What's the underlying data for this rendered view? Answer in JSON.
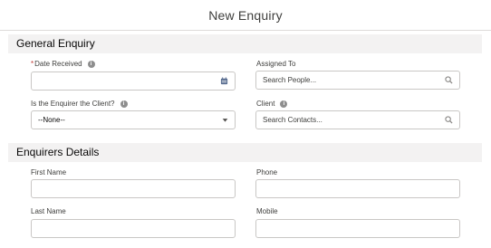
{
  "modal": {
    "title": "New Enquiry"
  },
  "sections": [
    {
      "title": "General Enquiry"
    },
    {
      "title": "Enquirers Details"
    }
  ],
  "fields": {
    "date_received": {
      "label": "Date Received",
      "value": ""
    },
    "assigned_to": {
      "label": "Assigned To",
      "placeholder": "Search People..."
    },
    "is_enquirer_client": {
      "label": "Is the Enquirer the Client?",
      "value": "--None--"
    },
    "client": {
      "label": "Client",
      "placeholder": "Search Contacts..."
    },
    "first_name": {
      "label": "First Name",
      "value": ""
    },
    "phone": {
      "label": "Phone",
      "value": ""
    },
    "last_name": {
      "label": "Last Name",
      "value": ""
    },
    "mobile": {
      "label": "Mobile",
      "value": ""
    }
  },
  "colors": {
    "required": "#c23934",
    "section_bg": "#f3f2f2",
    "border": "#c9c7c5",
    "icon": "#706e6b"
  }
}
